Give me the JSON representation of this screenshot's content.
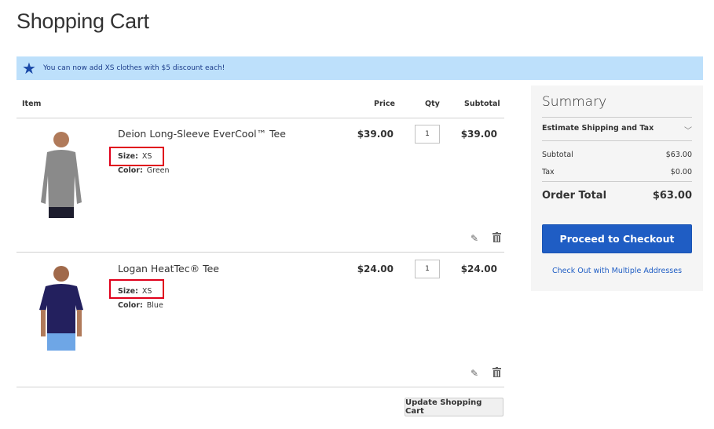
{
  "page": {
    "title": "Shopping Cart"
  },
  "banner": {
    "icon": "star-icon",
    "message": "You can now add XS clothes with $5 discount each!"
  },
  "table": {
    "headers": {
      "item": "Item",
      "price": "Price",
      "qty": "Qty",
      "subtotal": "Subtotal"
    },
    "rows": [
      {
        "name": "Deion Long-Sleeve EverCool™ Tee",
        "options": [
          {
            "label": "Size:",
            "value": "XS"
          },
          {
            "label": "Color:",
            "value": "Green"
          }
        ],
        "price": "$39.00",
        "qty": "1",
        "subtotal": "$39.00",
        "image_desc": "man in grey long-sleeve tee"
      },
      {
        "name": "Logan HeatTec® Tee",
        "options": [
          {
            "label": "Size:",
            "value": "XS"
          },
          {
            "label": "Color:",
            "value": "Blue"
          }
        ],
        "price": "$24.00",
        "qty": "1",
        "subtotal": "$24.00",
        "image_desc": "man in navy short-sleeve tee"
      }
    ]
  },
  "actions": {
    "edit_icon": "✎",
    "delete_icon": "🗑",
    "update_label": "Update Shopping Cart"
  },
  "summary": {
    "title": "Summary",
    "estimate_label": "Estimate Shipping and Tax",
    "chevron": "⌄",
    "subtotal_label": "Subtotal",
    "subtotal_value": "$63.00",
    "tax_label": "Tax",
    "tax_value": "$0.00",
    "total_label": "Order Total",
    "total_value": "$63.00",
    "checkout_label": "Proceed to Checkout",
    "multi_label": "Check Out with Multiple Addresses"
  },
  "colors": {
    "banner_bg": "#bde0fb",
    "primary": "#1f5dc4",
    "highlight": "#e0001b"
  }
}
